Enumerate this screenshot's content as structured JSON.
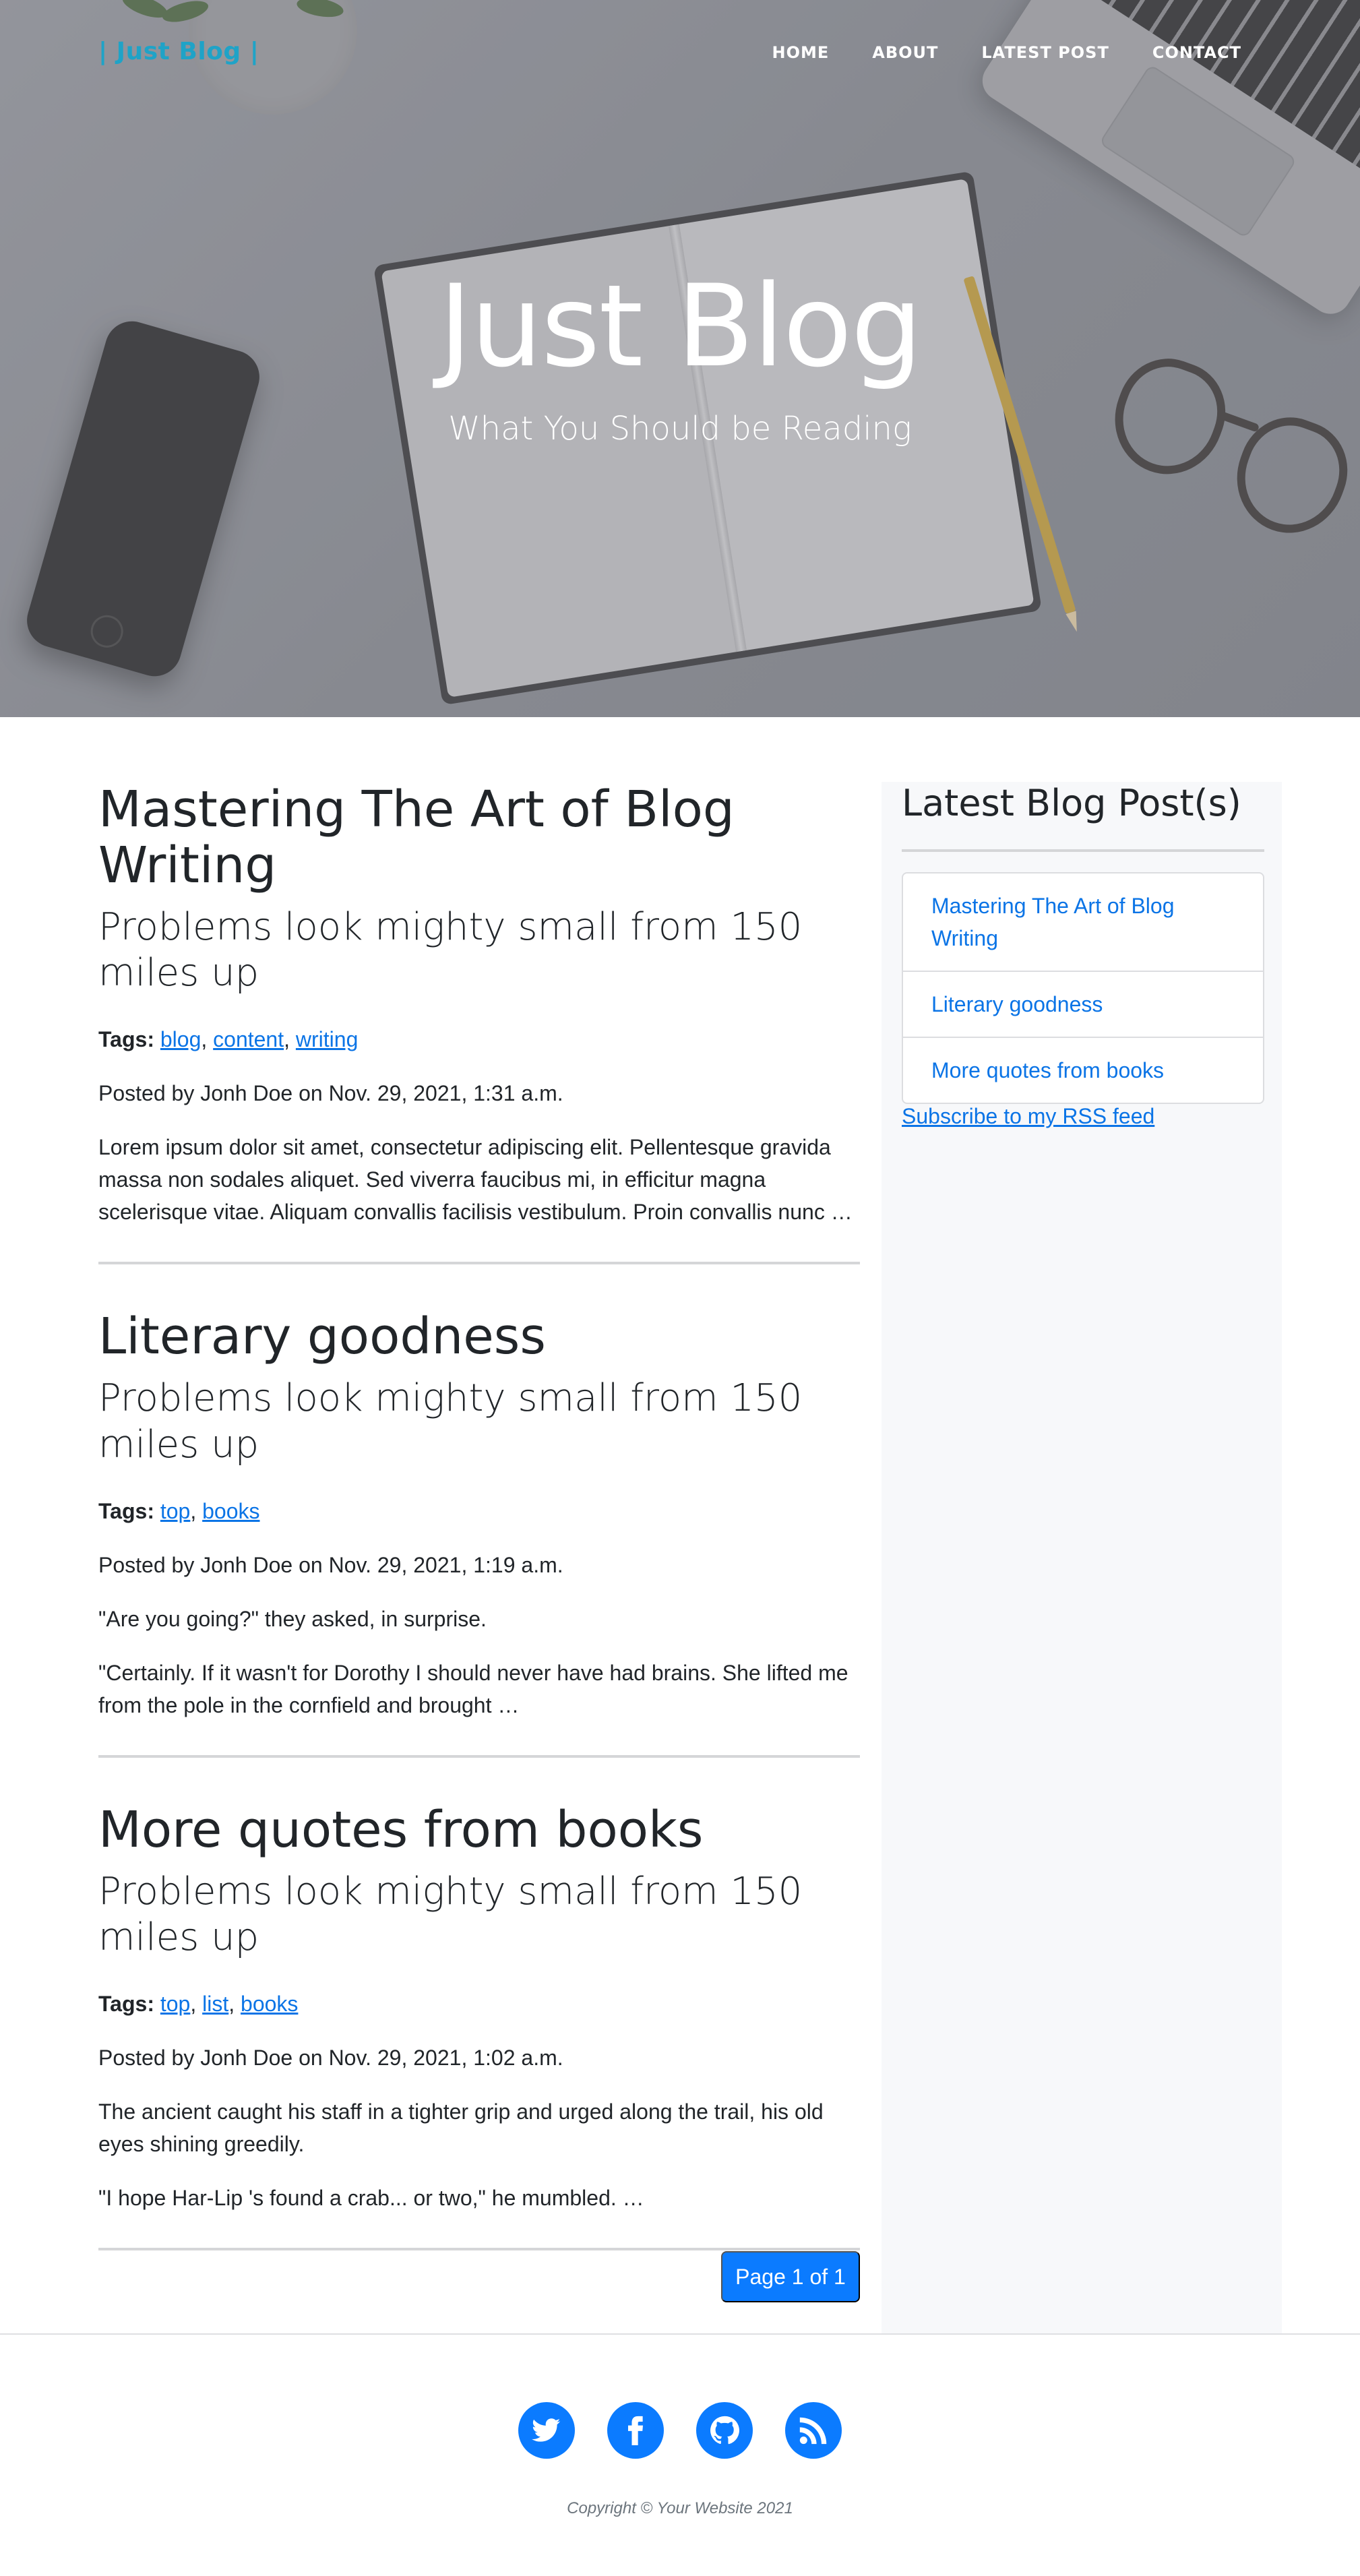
{
  "brand": "| Just Blog |",
  "nav": [
    "HOME",
    "ABOUT",
    "LATEST POST",
    "CONTACT"
  ],
  "hero": {
    "title": "Just Blog",
    "subtitle": "What You Should be Reading"
  },
  "posts": [
    {
      "title": "Mastering The Art of Blog Writing",
      "subtitle": "Problems look mighty small from 150 miles up",
      "tags_label": "Tags:",
      "tags": [
        "blog",
        "content",
        "writing"
      ],
      "posted": "Posted by Jonh Doe on Nov. 29, 2021, 1:31 a.m.",
      "excerpt": [
        "Lorem ipsum dolor sit amet, consectetur adipiscing elit. Pellentesque gravida massa non sodales aliquet. Sed viverra faucibus mi, in efficitur magna scelerisque vitae. Aliquam convallis facilisis vestibulum. Proin convallis nunc …"
      ]
    },
    {
      "title": "Literary goodness",
      "subtitle": "Problems look mighty small from 150 miles up",
      "tags_label": "Tags:",
      "tags": [
        "top",
        "books"
      ],
      "posted": "Posted by Jonh Doe on Nov. 29, 2021, 1:19 a.m.",
      "excerpt": [
        "\"Are you going?\" they asked, in surprise.",
        "\"Certainly. If it wasn't for Dorothy I should never have had brains. She lifted me from the pole in the cornfield and brought …"
      ]
    },
    {
      "title": "More quotes from books",
      "subtitle": "Problems look mighty small from 150 miles up",
      "tags_label": "Tags:",
      "tags": [
        "top",
        "list",
        "books"
      ],
      "posted": "Posted by Jonh Doe on Nov. 29, 2021, 1:02 a.m.",
      "excerpt": [
        "The ancient caught his staff in a tighter grip and urged along the trail, his old eyes shining greedily.",
        "\"I hope Har-Lip 's found a crab... or two,\" he mumbled. …"
      ]
    }
  ],
  "pager": "Page 1 of 1",
  "sidebar": {
    "title": "Latest Blog Post(s)",
    "items": [
      "Mastering The Art of Blog Writing",
      "Literary goodness",
      "More quotes from books"
    ],
    "rss": "Subscribe to my RSS feed"
  },
  "footer": {
    "socials": [
      "twitter-icon",
      "facebook-icon",
      "github-icon",
      "rss-icon"
    ],
    "copyright": "Copyright © Your Website 2021"
  },
  "colors": {
    "brand": "#1fa3c7",
    "link": "#0b74e6",
    "primary": "#0b7bff",
    "sidebar_bg": "#f7f8fa"
  }
}
